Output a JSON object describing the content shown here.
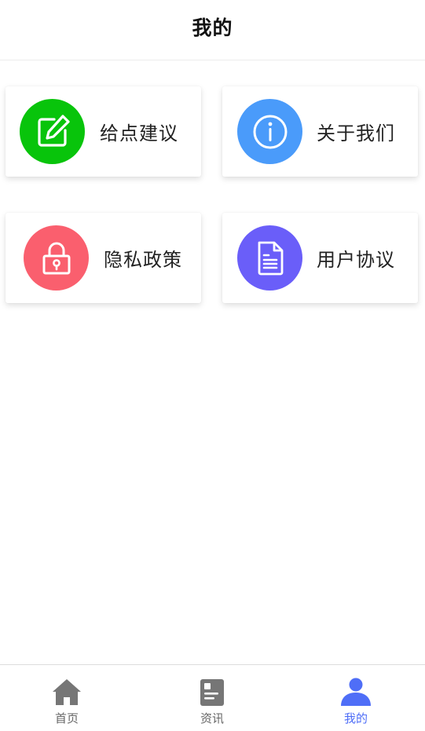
{
  "header": {
    "title": "我的"
  },
  "cards": [
    {
      "label": "给点建议",
      "icon": "edit-icon",
      "color": "#08c40b"
    },
    {
      "label": "关于我们",
      "icon": "info-icon",
      "color": "#4a9bfa"
    },
    {
      "label": "隐私政策",
      "icon": "lock-icon",
      "color": "#fa5f6e"
    },
    {
      "label": "用户协议",
      "icon": "document-icon",
      "color": "#6a5ef9"
    }
  ],
  "tabbar": {
    "tabs": [
      {
        "label": "首页",
        "icon": "home-icon",
        "active": false
      },
      {
        "label": "资讯",
        "icon": "news-icon",
        "active": false
      },
      {
        "label": "我的",
        "icon": "user-icon",
        "active": true
      }
    ],
    "active_color": "#4f6ef7",
    "inactive_color": "#666666"
  }
}
